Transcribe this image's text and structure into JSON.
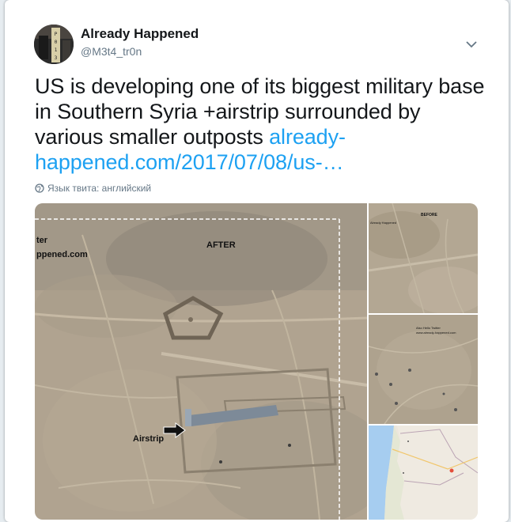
{
  "user": {
    "name": "Already Happened",
    "handle": "@M3t4_tr0n",
    "avatar_text": "P013"
  },
  "tweet": {
    "text": "US is developing one of its biggest military base in Southern Syria +airstrip surrounded by various smaller outposts ",
    "link_line1": "already-",
    "link_line2": "happened.com/2017/07/08/us-…"
  },
  "language_note": "Язык твита: английский",
  "media": {
    "main_label_after": "AFTER",
    "main_label_site_1": "ter",
    "main_label_site_2": "ppened.com",
    "main_label_airstrip": "Airstrip",
    "thumb1_label": "BEFORE",
    "thumb1_sublabel": "Already Happened",
    "thumb2_label_1": "Also Hello Twitter",
    "thumb2_label_2": "www.already-happened.com"
  },
  "icons": {
    "chevron": "chevron-down-icon",
    "globe": "globe-icon"
  },
  "colors": {
    "link": "#1da1f2",
    "text": "#14171a",
    "secondary": "#657786"
  }
}
